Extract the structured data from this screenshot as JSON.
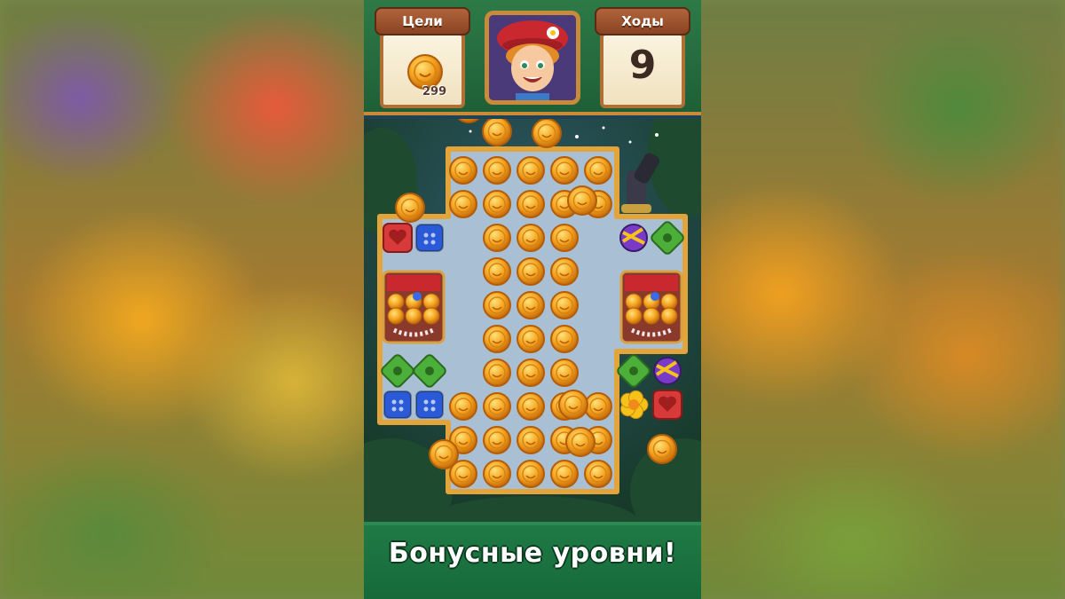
{
  "hud": {
    "goals_label": "Цели",
    "moves_label": "Ходы",
    "goal_count": "299",
    "moves_value": "9"
  },
  "banner": {
    "text": "Бонусные уровни!"
  },
  "icons": {
    "goal": "coin-icon",
    "tiles": [
      "coin-icon",
      "heart-tile-icon",
      "blue-button-tile-icon",
      "green-button-tile-icon",
      "flower-tile-icon",
      "treasure-chest-icon",
      "candy-bomb-icon",
      "cannon-icon"
    ]
  },
  "colors": {
    "hud_green": "#2d7a47",
    "wood": "#b0643a",
    "coin": "#f5a623",
    "board": "#a9c0d4",
    "banner": "#1f7a45"
  }
}
